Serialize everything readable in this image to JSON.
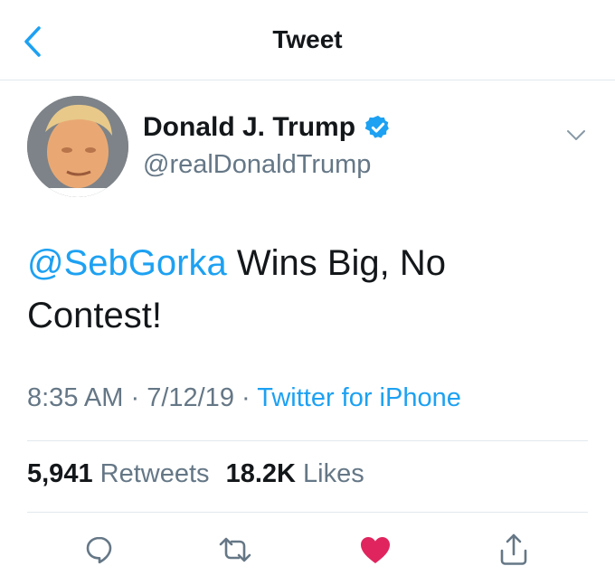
{
  "header": {
    "title": "Tweet"
  },
  "author": {
    "display_name": "Donald J. Trump",
    "handle": "@realDonaldTrump",
    "verified": true
  },
  "tweet": {
    "mention": "@SebGorka",
    "text": " Wins Big, No Contest!"
  },
  "meta": {
    "time": "8:35 AM",
    "sep1": " · ",
    "date": "7/12/19",
    "sep2": " · ",
    "source": "Twitter for iPhone"
  },
  "stats": {
    "retweets_count": "5,941",
    "retweets_label": "Retweets",
    "likes_count": "18.2K",
    "likes_label": "Likes"
  },
  "colors": {
    "accent": "#1da1f2",
    "like": "#e0245e",
    "secondary_text": "#657786"
  },
  "icons": {
    "back": "chevron-left-icon",
    "caret": "chevron-down-icon",
    "verified": "verified-badge-icon",
    "reply": "reply-icon",
    "retweet": "retweet-icon",
    "like": "heart-icon",
    "share": "share-icon"
  }
}
